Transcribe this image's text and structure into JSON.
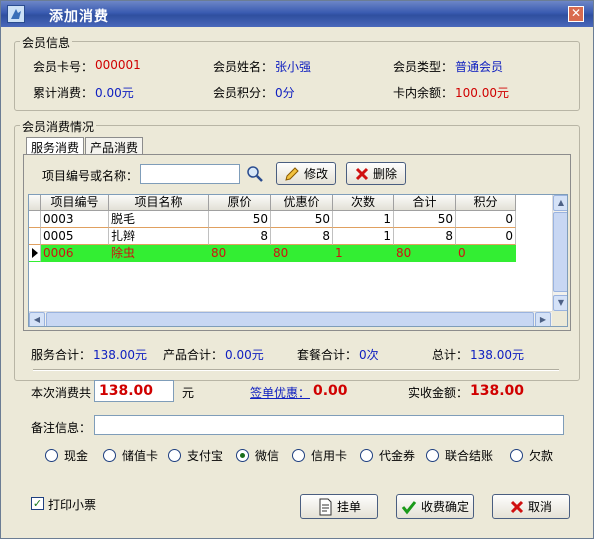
{
  "window": {
    "title": "添加消费"
  },
  "member_info": {
    "group_title": "会员信息",
    "card_no": {
      "label": "会员卡号：",
      "value": "000001"
    },
    "name": {
      "label": "会员姓名：",
      "value": "张小强"
    },
    "type": {
      "label": "会员类型：",
      "value": "普通会员"
    },
    "total": {
      "label": "累计消费：",
      "value": "0.00元"
    },
    "points": {
      "label": "会员积分：",
      "value": "0分"
    },
    "balance": {
      "label": "卡内余额：",
      "value": "100.00元"
    }
  },
  "consume": {
    "group_title": "会员消费情况",
    "tabs": [
      "服务消费",
      "产品消费"
    ],
    "search_label": "项目编号或名称：",
    "search_value": "",
    "edit_label": "修改",
    "delete_label": "删除"
  },
  "table": {
    "columns": [
      "项目编号",
      "项目名称",
      "原价",
      "优惠价",
      "次数",
      "合计",
      "积分"
    ],
    "rows": [
      [
        "0003",
        "脱毛",
        "50",
        "50",
        "1",
        "50",
        "0"
      ],
      [
        "0005",
        "扎辫",
        "8",
        "8",
        "1",
        "8",
        "0"
      ],
      [
        "0006",
        "除虫",
        "80",
        "80",
        "1",
        "80",
        "0"
      ]
    ],
    "selected_row": 2
  },
  "summary": {
    "service": {
      "label": "服务合计：",
      "value": "138.00元"
    },
    "product": {
      "label": "产品合计：",
      "value": "0.00元"
    },
    "package": {
      "label": "套餐合计：",
      "value": "0次"
    },
    "total": {
      "label": "总计：",
      "value": "138.00元"
    }
  },
  "payment": {
    "label": "本次消费共",
    "amount": "138.00",
    "unit": "元",
    "discount_link": "签单优惠：",
    "discount_value": "0.00",
    "actual_label": "实收金额：",
    "actual_value": "138.00",
    "remark_label": "备注信息：",
    "remark_value": ""
  },
  "methods": {
    "options": [
      "现金",
      "储值卡",
      "支付宝",
      "微信",
      "信用卡",
      "代金券",
      "联合结账",
      "欠款"
    ],
    "selected": "微信"
  },
  "footer": {
    "print_label": "打印小票",
    "print_checked": true,
    "hang_label": "挂单",
    "confirm_label": "收费确定",
    "cancel_label": "取消"
  },
  "colors": {
    "selected_row_bg": "#33ee33",
    "value_blue": "#1020c0",
    "value_red": "#d00000"
  }
}
